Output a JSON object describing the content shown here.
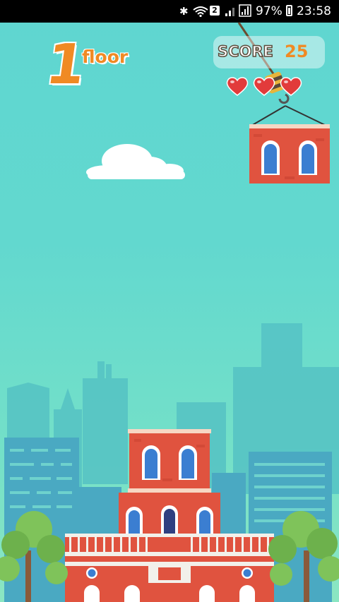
{
  "status_bar": {
    "sim_slot": "2",
    "battery": "97%",
    "time": "23:58",
    "icons": [
      "bluetooth-icon",
      "wifi-icon",
      "signal-icon",
      "signal-icon",
      "battery-icon"
    ]
  },
  "hud": {
    "floor_number": "1",
    "floor_label": "floor",
    "score_label": "SCORE",
    "score_value": "25",
    "lives": 3
  },
  "colors": {
    "sky_top": "#5fd6d0",
    "accent_orange": "#f08a24",
    "brick": "#e0533f",
    "heart": "#e23b3b"
  }
}
